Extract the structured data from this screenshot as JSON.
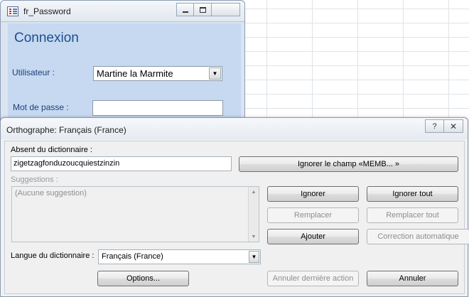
{
  "back_window": {
    "title": "fr_Password",
    "form_title": "Connexion",
    "user_label": "Utilisateur :",
    "user_value": "Martine la Marmite",
    "password_label": "Mot de passe :"
  },
  "dialog": {
    "title": "Orthographe: Français (France)",
    "help_label": "?",
    "close_label": "✕",
    "not_in_dict_label": "Absent du dictionnaire :",
    "not_in_dict_value": "zigetzagfonduzoucquiestzinzin",
    "suggestions_label": "Suggestions :",
    "no_suggestion": "(Aucune suggestion)",
    "dict_lang_label": "Langue du dictionnaire :",
    "dict_lang_value": "Français (France)",
    "buttons": {
      "ignore_field": "Ignorer le champ «MEMB... »",
      "ignore": "Ignorer",
      "ignore_all": "Ignorer tout",
      "replace": "Remplacer",
      "replace_all": "Remplacer tout",
      "add": "Ajouter",
      "autocorrect": "Correction automatique",
      "options": "Options...",
      "undo_last": "Annuler dernière action",
      "cancel": "Annuler"
    }
  },
  "icons": {
    "scroll_up": "▲",
    "scroll_down": "▼",
    "dropdown": "▼"
  }
}
